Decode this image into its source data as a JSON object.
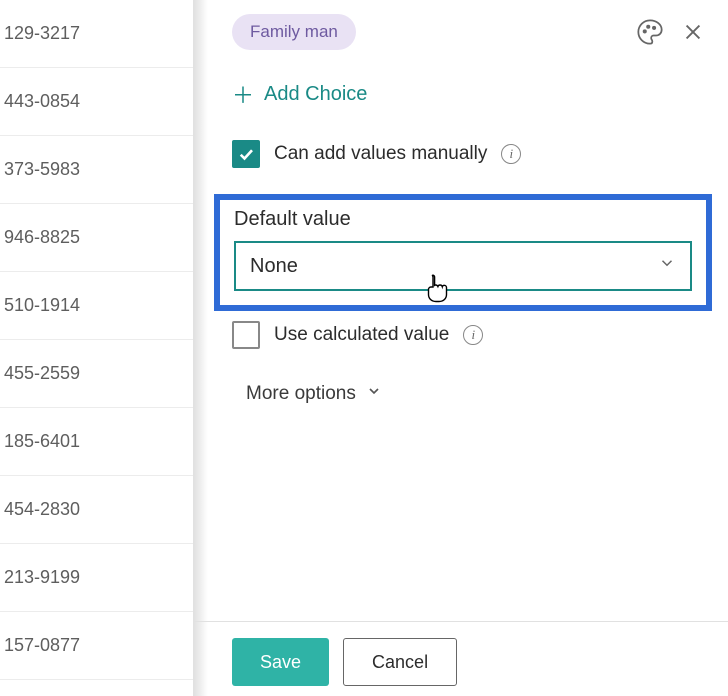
{
  "left_column": {
    "rows": [
      "129-3217",
      "443-0854",
      "373-5983",
      "946-8825",
      "510-1914",
      "455-2559",
      "185-6401",
      "454-2830",
      "213-9199",
      "157-0877"
    ]
  },
  "panel": {
    "choice_tag": "Family man",
    "add_choice_label": "Add Choice",
    "can_add_values_label": "Can add values manually",
    "default_value_label": "Default value",
    "default_value_selected": "None",
    "use_calculated_label": "Use calculated value",
    "more_options_label": "More options"
  },
  "footer": {
    "save_label": "Save",
    "cancel_label": "Cancel"
  }
}
